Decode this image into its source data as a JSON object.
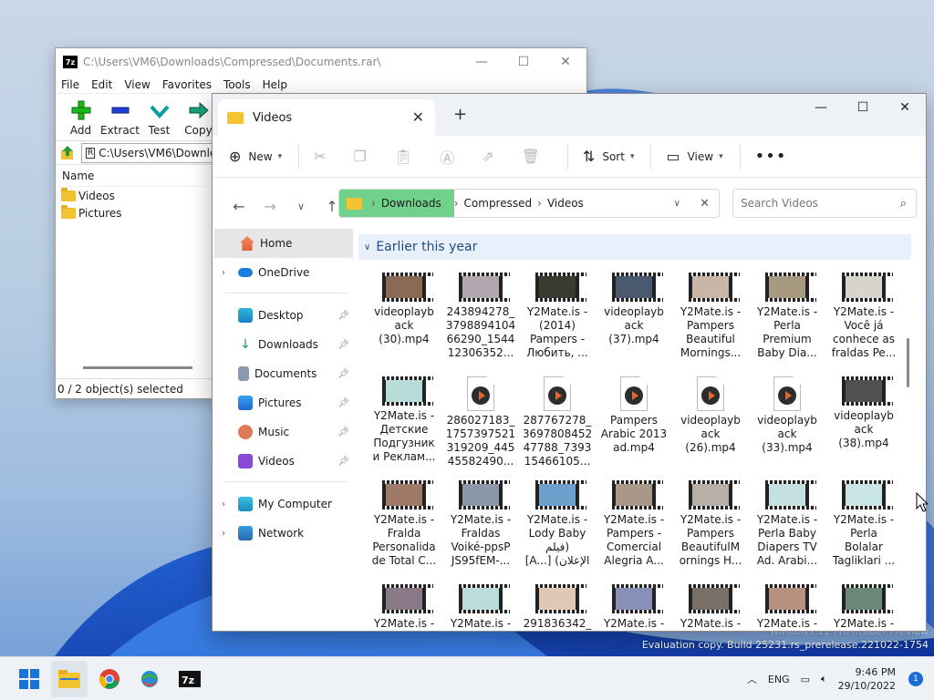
{
  "desktop": {
    "watermark_line1": "Windows 11 Pro Insider Preview",
    "watermark_line2": "Evaluation copy. Build 25231.rs_prerelease.221022-1754"
  },
  "zip": {
    "title": "C:\\Users\\VM6\\Downloads\\Compressed\\Documents.rar\\",
    "menu": [
      "File",
      "Edit",
      "View",
      "Favorites",
      "Tools",
      "Help"
    ],
    "toolbar": {
      "add": "Add",
      "extract": "Extract",
      "test": "Test",
      "copy": "Copy"
    },
    "address": "C:\\Users\\VM6\\Downlo",
    "column_name": "Name",
    "items": [
      "Videos",
      "Pictures"
    ],
    "status": "0 / 2 object(s) selected"
  },
  "explorer": {
    "tab_title": "Videos",
    "cmd": {
      "new": "New",
      "sort": "Sort",
      "view": "View"
    },
    "crumbs": [
      "Downloads",
      "Compressed",
      "Videos"
    ],
    "search_placeholder": "Search Videos",
    "nav": {
      "home": "Home",
      "onedrive": "OneDrive",
      "desktop": "Desktop",
      "downloads": "Downloads",
      "documents": "Documents",
      "pictures": "Pictures",
      "music": "Music",
      "videos": "Videos",
      "mycomputer": "My Computer",
      "network": "Network"
    },
    "group_header": "Earlier this year",
    "files": [
      {
        "label": "videoplayb\nack\n(30).mp4",
        "kind": "video",
        "thumb": "#8a6a55"
      },
      {
        "label": "243894278_\n3798894104\n66290_1544\n12306352...",
        "kind": "video",
        "thumb": "#b0a8ae"
      },
      {
        "label": "Y2Mate.is -\n(2014)\nPampers -\nЛюбить, ...",
        "kind": "video",
        "thumb": "#3a3a30"
      },
      {
        "label": "videoplayb\nack\n(37).mp4",
        "kind": "video",
        "thumb": "#4a5870"
      },
      {
        "label": "Y2Mate.is -\nPampers\nBeautiful\nMornings...",
        "kind": "video",
        "thumb": "#c8b6a8"
      },
      {
        "label": "Y2Mate.is -\nPerla\nPremium\nBaby Dia...",
        "kind": "video",
        "thumb": "#a89a80"
      },
      {
        "label": "Y2Mate.is -\nVocê já\nconhece as\nfraldas Pe...",
        "kind": "video",
        "thumb": "#d8d4cc"
      },
      {
        "label": "Y2Mate.is -\nДетские\nПодгузник\nи Реклам...",
        "kind": "video",
        "thumb": "#b8dcd8"
      },
      {
        "label": "286027183_\n1757397521\n319209_445\n45582490...",
        "kind": "media",
        "thumb": ""
      },
      {
        "label": "287767278_\n3697808452\n47788_7393\n15466105...",
        "kind": "media",
        "thumb": ""
      },
      {
        "label": "Pampers\nArabic 2013\nad.mp4",
        "kind": "media",
        "thumb": ""
      },
      {
        "label": "videoplayb\nack\n(26).mp4",
        "kind": "media",
        "thumb": ""
      },
      {
        "label": "videoplayb\nack\n(33).mp4",
        "kind": "media",
        "thumb": ""
      },
      {
        "label": "videoplayb\nack\n(38).mp4",
        "kind": "video",
        "thumb": "#505050"
      },
      {
        "label": "Y2Mate.is -\nFralda\nPersonalida\nde Total C...",
        "kind": "video",
        "thumb": "#a07a68"
      },
      {
        "label": "Y2Mate.is -\nFraldas\nVoiké-ppsP\nJS95fEM-...",
        "kind": "video",
        "thumb": "#8a98a8"
      },
      {
        "label": "Y2Mate.is -\nLody Baby\nفيلم)\n[A...] (الإعلان",
        "kind": "video",
        "thumb": "#6ea0cc"
      },
      {
        "label": "Y2Mate.is -\nPampers -\nComercial\nAlegria A...",
        "kind": "video",
        "thumb": "#a89888"
      },
      {
        "label": "Y2Mate.is -\nPampers\nBeautifulM\nornings H...",
        "kind": "video",
        "thumb": "#b8b0a8"
      },
      {
        "label": "Y2Mate.is -\nPerla Baby\nDiapers TV\nAd. Arabi...",
        "kind": "video",
        "thumb": "#c4e0e0"
      },
      {
        "label": "Y2Mate.is -\nPerla\nBolalar\nTagliklari ...",
        "kind": "video",
        "thumb": "#c8e4e4"
      },
      {
        "label": "Y2Mate.is -",
        "kind": "video",
        "thumb": "#8a7a88"
      },
      {
        "label": "Y2Mate.is -",
        "kind": "video",
        "thumb": "#bcdcdc"
      },
      {
        "label": "291836342_",
        "kind": "video",
        "thumb": "#e0c8b4"
      },
      {
        "label": "Y2Mate.is -",
        "kind": "video",
        "thumb": "#8890b8"
      },
      {
        "label": "Y2Mate.is -",
        "kind": "video",
        "thumb": "#787068"
      },
      {
        "label": "Y2Mate.is -",
        "kind": "video",
        "thumb": "#b89080"
      },
      {
        "label": "Y2Mate.is -",
        "kind": "video",
        "thumb": "#6a8878"
      }
    ]
  },
  "taskbar": {
    "lang": "ENG",
    "time": "9:46 PM",
    "date": "29/10/2022",
    "notifications": "1"
  }
}
